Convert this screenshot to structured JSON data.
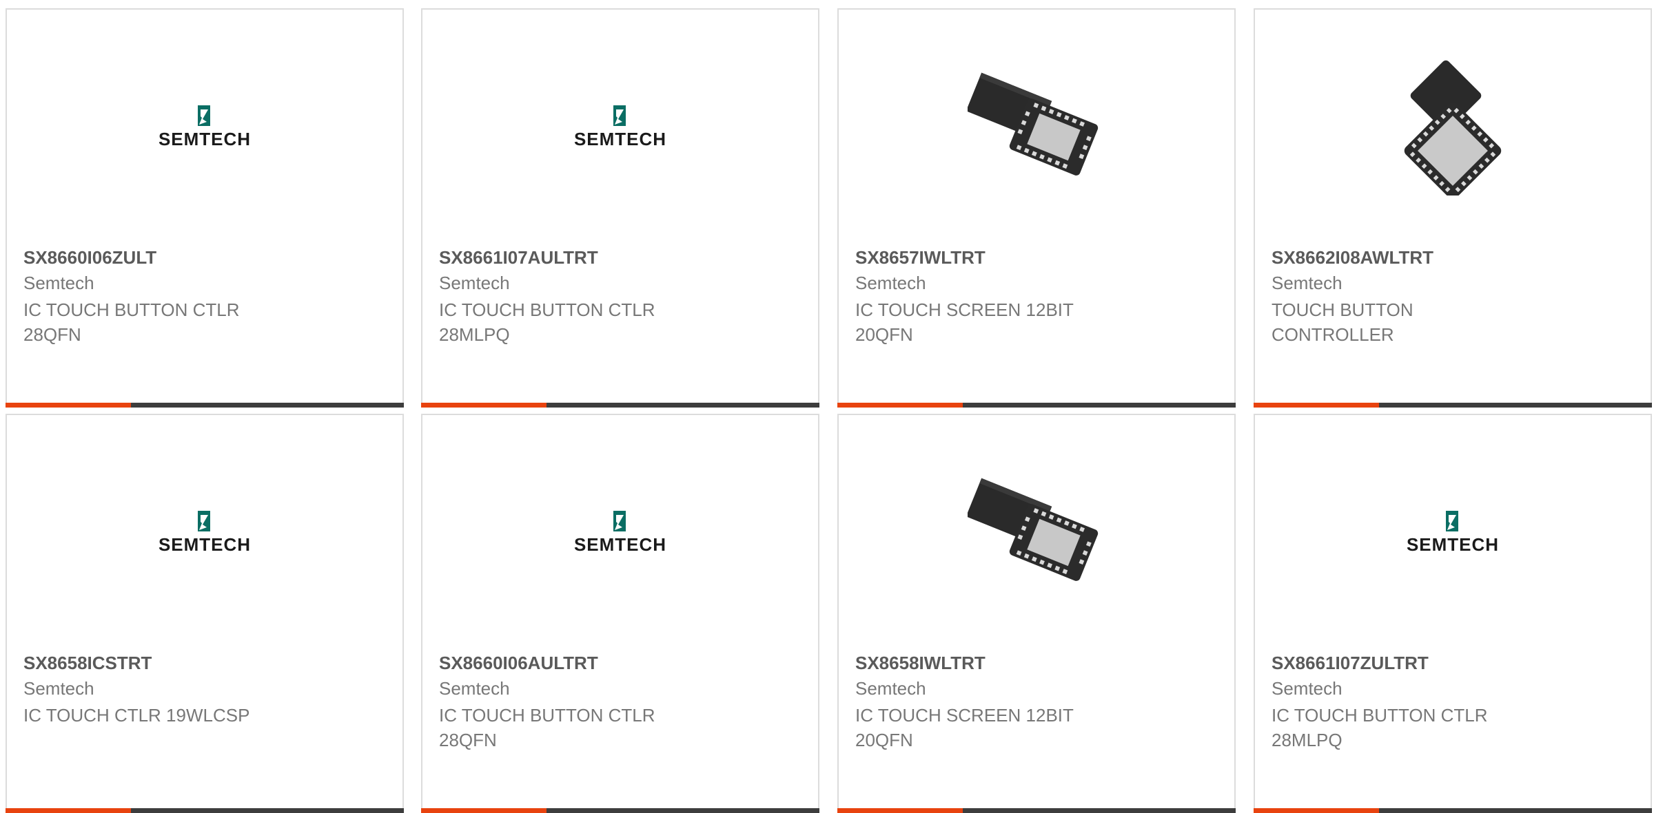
{
  "colors": {
    "accent": "#e8430f",
    "bar_dark": "#3d3d3d",
    "semtech_green": "#0b6e64"
  },
  "products": [
    {
      "part": "SX8660I06ZULT",
      "maker": "Semtech",
      "desc": "IC TOUCH BUTTON CTLR 28QFN",
      "image": "semtech-logo"
    },
    {
      "part": "SX8661I07AULTRT",
      "maker": "Semtech",
      "desc": "IC TOUCH BUTTON CTLR 28MLPQ",
      "image": "semtech-logo"
    },
    {
      "part": "SX8657IWLTRT",
      "maker": "Semtech",
      "desc": "IC TOUCH SCREEN 12BIT 20QFN",
      "image": "qfn-chip-photo"
    },
    {
      "part": "SX8662I08AWLTRT",
      "maker": "Semtech",
      "desc": "TOUCH BUTTON CONTROLLER",
      "image": "qfn-chip-photo-large"
    },
    {
      "part": "SX8658ICSTRT",
      "maker": "Semtech",
      "desc": "IC TOUCH CTLR 19WLCSP",
      "image": "semtech-logo"
    },
    {
      "part": "SX8660I06AULTRT",
      "maker": "Semtech",
      "desc": "IC TOUCH BUTTON CTLR 28QFN",
      "image": "semtech-logo"
    },
    {
      "part": "SX8658IWLTRT",
      "maker": "Semtech",
      "desc": "IC TOUCH SCREEN 12BIT 20QFN",
      "image": "qfn-chip-photo"
    },
    {
      "part": "SX8661I07ZULTRT",
      "maker": "Semtech",
      "desc": "IC TOUCH BUTTON CTLR 28MLPQ",
      "image": "semtech-logo"
    }
  ]
}
